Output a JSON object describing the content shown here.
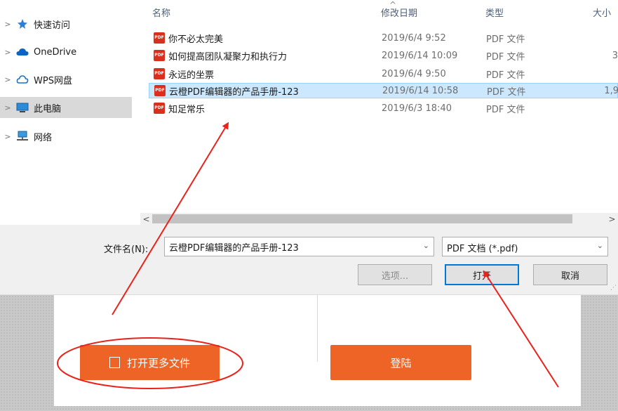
{
  "nav": {
    "items": [
      {
        "label": "快速访问",
        "icon": "pin-icon"
      },
      {
        "label": "OneDrive",
        "icon": "cloud-icon"
      },
      {
        "label": "WPS网盘",
        "icon": "wps-cloud-icon"
      },
      {
        "label": "此电脑",
        "icon": "computer-icon"
      },
      {
        "label": "网络",
        "icon": "network-icon"
      }
    ]
  },
  "columns": {
    "name": "名称",
    "date": "修改日期",
    "type": "类型",
    "size": "大小",
    "sort_indicator": "^"
  },
  "files": [
    {
      "name": "你不必太完美",
      "date": "2019/6/4 9:52",
      "type": "PDF 文件",
      "size": ""
    },
    {
      "name": "如何提高团队凝聚力和执行力",
      "date": "2019/6/14 10:09",
      "type": "PDF 文件",
      "size": "3"
    },
    {
      "name": "永远的坐票",
      "date": "2019/6/4 9:50",
      "type": "PDF 文件",
      "size": ""
    },
    {
      "name": "云橙PDF编辑器的产品手册-123",
      "date": "2019/6/14 10:58",
      "type": "PDF 文件",
      "size": "1,9"
    },
    {
      "name": "知足常乐",
      "date": "2019/6/3 18:40",
      "type": "PDF 文件",
      "size": ""
    }
  ],
  "file_icon_text": "PDF",
  "filename": {
    "label": "文件名(N):",
    "value": "云橙PDF编辑器的产品手册-123"
  },
  "filetype": {
    "value": "PDF 文档 (*.pdf)"
  },
  "buttons": {
    "options": "选项...",
    "open": "打开",
    "cancel": "取消"
  },
  "background_app": {
    "open_more": "打开更多文件",
    "login": "登陆"
  },
  "colors": {
    "accent_orange": "#ee6426",
    "annotation_red": "#e8231c",
    "selection_blue": "#cce8ff",
    "focus_blue": "#0078d7"
  }
}
